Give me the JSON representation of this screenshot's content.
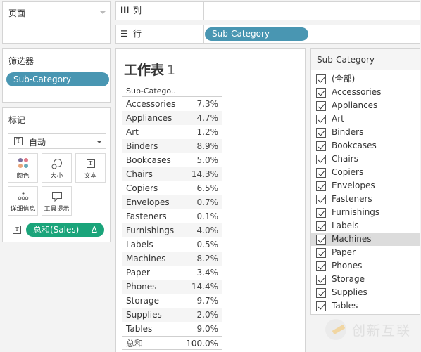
{
  "pages_card": {
    "title": "页面"
  },
  "filters_card": {
    "title": "筛选器",
    "pill": "Sub-Category"
  },
  "marks_card": {
    "title": "标记",
    "mark_type": "自动",
    "buttons": [
      {
        "label": "颜色",
        "icon": "color-dots-icon"
      },
      {
        "label": "大小",
        "icon": "size-icon"
      },
      {
        "label": "文本",
        "icon": "text-icon"
      },
      {
        "label": "详细信息",
        "icon": "detail-icon"
      },
      {
        "label": "工具提示",
        "icon": "tooltip-icon"
      }
    ],
    "field_pill": "总和(Sales)",
    "field_pill_badge": "Δ"
  },
  "shelves": {
    "columns": {
      "label": "列",
      "glyph": "iii"
    },
    "rows": {
      "label": "行",
      "glyph": "☰",
      "pill": "Sub-Category"
    }
  },
  "worksheet": {
    "title": "工作表",
    "title_num": "1",
    "column_header": "Sub-Catego..",
    "rows": [
      {
        "name": "Accessories",
        "value": "7.3%"
      },
      {
        "name": "Appliances",
        "value": "4.7%"
      },
      {
        "name": "Art",
        "value": "1.2%"
      },
      {
        "name": "Binders",
        "value": "8.9%"
      },
      {
        "name": "Bookcases",
        "value": "5.0%"
      },
      {
        "name": "Chairs",
        "value": "14.3%"
      },
      {
        "name": "Copiers",
        "value": "6.5%"
      },
      {
        "name": "Envelopes",
        "value": "0.7%"
      },
      {
        "name": "Fasteners",
        "value": "0.1%"
      },
      {
        "name": "Furnishings",
        "value": "4.0%"
      },
      {
        "name": "Labels",
        "value": "0.5%"
      },
      {
        "name": "Machines",
        "value": "8.2%"
      },
      {
        "name": "Paper",
        "value": "3.4%"
      },
      {
        "name": "Phones",
        "value": "14.4%"
      },
      {
        "name": "Storage",
        "value": "9.7%"
      },
      {
        "name": "Supplies",
        "value": "2.0%"
      },
      {
        "name": "Tables",
        "value": "9.0%"
      }
    ],
    "total": {
      "name": "总和",
      "value": "100.0%"
    }
  },
  "quick_filter": {
    "title": "Sub-Category",
    "items": [
      {
        "label": "(全部)",
        "checked": true
      },
      {
        "label": "Accessories",
        "checked": true
      },
      {
        "label": "Appliances",
        "checked": true
      },
      {
        "label": "Art",
        "checked": true
      },
      {
        "label": "Binders",
        "checked": true
      },
      {
        "label": "Bookcases",
        "checked": true
      },
      {
        "label": "Chairs",
        "checked": true
      },
      {
        "label": "Copiers",
        "checked": true
      },
      {
        "label": "Envelopes",
        "checked": true
      },
      {
        "label": "Fasteners",
        "checked": true
      },
      {
        "label": "Furnishings",
        "checked": true
      },
      {
        "label": "Labels",
        "checked": true
      },
      {
        "label": "Machines",
        "checked": true,
        "hovered": true
      },
      {
        "label": "Paper",
        "checked": true
      },
      {
        "label": "Phones",
        "checked": true
      },
      {
        "label": "Storage",
        "checked": true
      },
      {
        "label": "Supplies",
        "checked": true
      },
      {
        "label": "Tables",
        "checked": true
      }
    ]
  },
  "watermark": {
    "text": "创新互联"
  },
  "colors": {
    "dimension_pill": "#4996b2",
    "measure_pill": "#1aa47a",
    "dot_purple": "#7d6f9c",
    "dot_pink": "#e07b8a",
    "dot_orange": "#e9a57a",
    "dot_teal": "#6aaab9"
  }
}
